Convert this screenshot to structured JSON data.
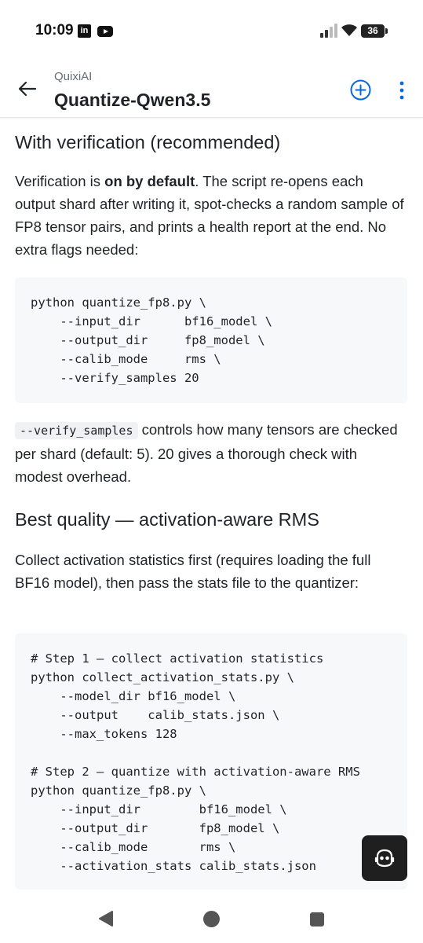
{
  "status_bar": {
    "time": "10:09",
    "battery": "36",
    "apps": [
      "linkedin-icon",
      "youtube-icon"
    ]
  },
  "header": {
    "owner": "QuixiAI",
    "repo": "Quantize-Qwen3.5"
  },
  "sections": {
    "verification": {
      "heading": "With verification (recommended)",
      "intro_before": "Verification is ",
      "intro_bold": "on by default",
      "intro_after": ". The script re-opens each output shard after writing it, spot-checks a random sample of FP8 tensor pairs, and prints a health report at the end. No extra flags needed:",
      "code": "python quantize_fp8.py \\\n    --input_dir      bf16_model \\\n    --output_dir     fp8_model \\\n    --calib_mode     rms \\\n    --verify_samples 20",
      "note_code": "--verify_samples",
      "note_text": " controls how many tensors are checked per shard (default: 5). 20 gives a thorough check with modest overhead."
    },
    "best_quality": {
      "heading": "Best quality — activation-aware RMS",
      "intro": "Collect activation statistics first (requires loading the full BF16 model), then pass the stats file to the quantizer:",
      "code": "# Step 1 — collect activation statistics\npython collect_activation_stats.py \\\n    --model_dir bf16_model \\\n    --output    calib_stats.json \\\n    --max_tokens 128\n\n# Step 2 — quantize with activation-aware RMS\npython quantize_fp8.py \\\n    --input_dir        bf16_model \\\n    --output_dir       fp8_model \\\n    --calib_mode       rms \\\n    --activation_stats calib_stats.json"
    }
  },
  "icons": {
    "back": "arrow-left-icon",
    "add": "plus-circle-icon",
    "more": "kebab-menu-icon",
    "fab": "copilot-icon"
  },
  "colors": {
    "accent": "#0969da",
    "text": "#1f2328",
    "code_bg": "#f6f8fa"
  }
}
